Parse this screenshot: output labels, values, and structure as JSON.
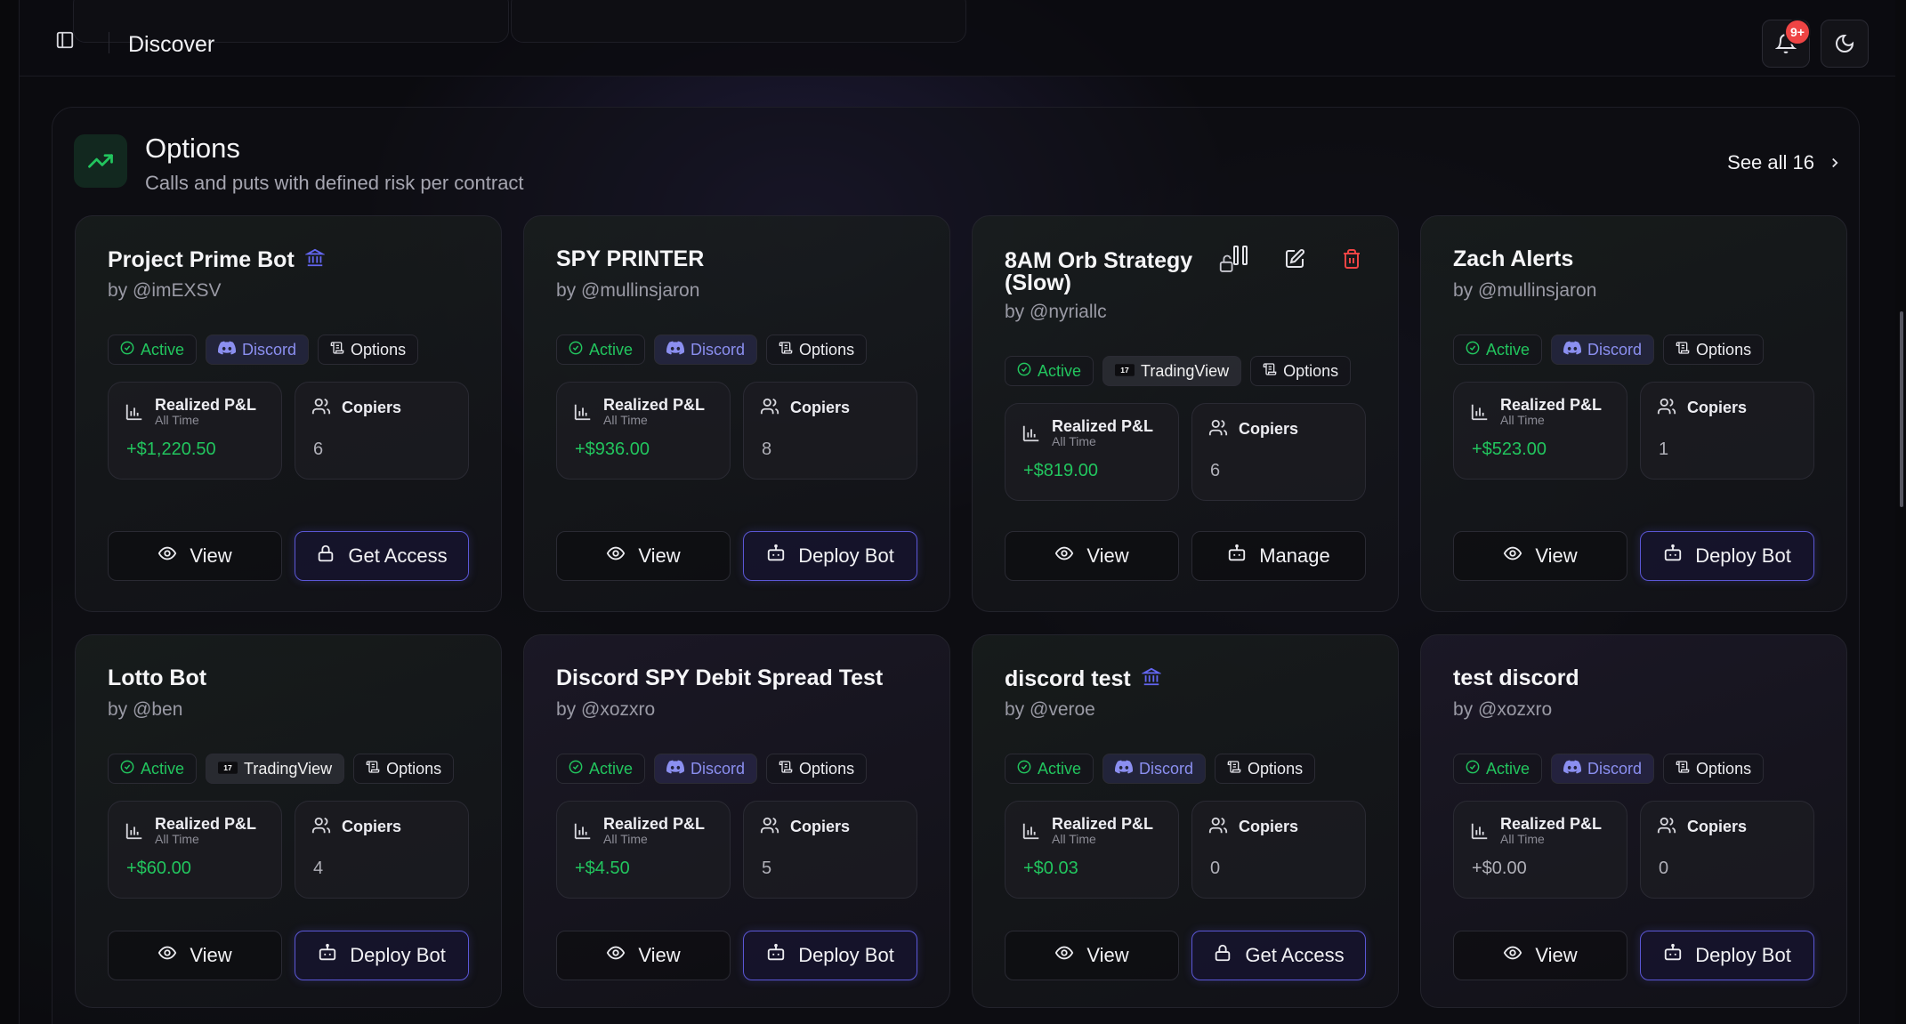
{
  "header": {
    "title": "Discover",
    "notification_count": "9+"
  },
  "section": {
    "title": "Options",
    "subtitle": "Calls and puts with defined risk per contract",
    "see_all": "See all 16"
  },
  "colors": {
    "accent": "#5b57d6",
    "positive": "#22c55e",
    "danger": "#ef4444",
    "discord": "#8b8ff0"
  },
  "cards": [
    {
      "title": "Project Prime Bot",
      "verified": true,
      "author": "by @imEXSV",
      "status": "Active",
      "source": "Discord",
      "source_icon": "discord-icon",
      "category": "Options",
      "pnl_label": "Realized P&L",
      "pnl_sub": "All Time",
      "pnl_value": "+$1,220.50",
      "pnl_positive": true,
      "copiers_label": "Copiers",
      "copiers_value": "6",
      "view_label": "View",
      "action_label": "Get Access",
      "action_icon": "lock-icon"
    },
    {
      "title": "SPY PRINTER",
      "verified": false,
      "author": "by @mullinsjaron",
      "status": "Active",
      "source": "Discord",
      "source_icon": "discord-icon",
      "category": "Options",
      "pnl_label": "Realized P&L",
      "pnl_sub": "All Time",
      "pnl_value": "+$936.00",
      "pnl_positive": true,
      "copiers_label": "Copiers",
      "copiers_value": "8",
      "view_label": "View",
      "action_label": "Deploy Bot",
      "action_icon": "bot-icon"
    },
    {
      "title": "8AM Orb Strategy (Slow)",
      "verified": false,
      "author": "by @nyriallc",
      "status": "Active",
      "source": "TradingView",
      "source_icon": "tradingview-icon",
      "category": "Options",
      "pnl_label": "Realized P&L",
      "pnl_sub": "All Time",
      "pnl_value": "+$819.00",
      "pnl_positive": true,
      "copiers_label": "Copiers",
      "copiers_value": "6",
      "view_label": "View",
      "action_label": "Manage",
      "action_icon": "bot-icon",
      "owner_actions": [
        "unlock-icon",
        "pause-icon",
        "edit-icon",
        "trash-icon"
      ]
    },
    {
      "title": "Zach Alerts",
      "verified": false,
      "author": "by @mullinsjaron",
      "status": "Active",
      "source": "Discord",
      "source_icon": "discord-icon",
      "category": "Options",
      "pnl_label": "Realized P&L",
      "pnl_sub": "All Time",
      "pnl_value": "+$523.00",
      "pnl_positive": true,
      "copiers_label": "Copiers",
      "copiers_value": "1",
      "view_label": "View",
      "action_label": "Deploy Bot",
      "action_icon": "bot-icon"
    },
    {
      "title": "Lotto Bot",
      "verified": false,
      "author": "by @ben",
      "status": "Active",
      "source": "TradingView",
      "source_icon": "tradingview-icon",
      "category": "Options",
      "pnl_label": "Realized P&L",
      "pnl_sub": "All Time",
      "pnl_value": "+$60.00",
      "pnl_positive": true,
      "copiers_label": "Copiers",
      "copiers_value": "4",
      "view_label": "View",
      "action_label": "Deploy Bot",
      "action_icon": "bot-icon"
    },
    {
      "title": "Discord SPY Debit Spread Test",
      "verified": false,
      "author": "by @xozxro",
      "status": "Active",
      "source": "Discord",
      "source_icon": "discord-icon",
      "category": "Options",
      "pnl_label": "Realized P&L",
      "pnl_sub": "All Time",
      "pnl_value": "+$4.50",
      "pnl_positive": true,
      "copiers_label": "Copiers",
      "copiers_value": "5",
      "view_label": "View",
      "action_label": "Deploy Bot",
      "action_icon": "bot-icon"
    },
    {
      "title": "discord test",
      "verified": true,
      "author": "by @veroe",
      "status": "Active",
      "source": "Discord",
      "source_icon": "discord-icon",
      "category": "Options",
      "pnl_label": "Realized P&L",
      "pnl_sub": "All Time",
      "pnl_value": "+$0.03",
      "pnl_positive": true,
      "copiers_label": "Copiers",
      "copiers_value": "0",
      "view_label": "View",
      "action_label": "Get Access",
      "action_icon": "lock-icon"
    },
    {
      "title": "test discord",
      "verified": false,
      "author": "by @xozxro",
      "status": "Active",
      "source": "Discord",
      "source_icon": "discord-icon",
      "category": "Options",
      "pnl_label": "Realized P&L",
      "pnl_sub": "All Time",
      "pnl_value": "+$0.00",
      "pnl_positive": false,
      "copiers_label": "Copiers",
      "copiers_value": "0",
      "view_label": "View",
      "action_label": "Deploy Bot",
      "action_icon": "bot-icon"
    }
  ]
}
